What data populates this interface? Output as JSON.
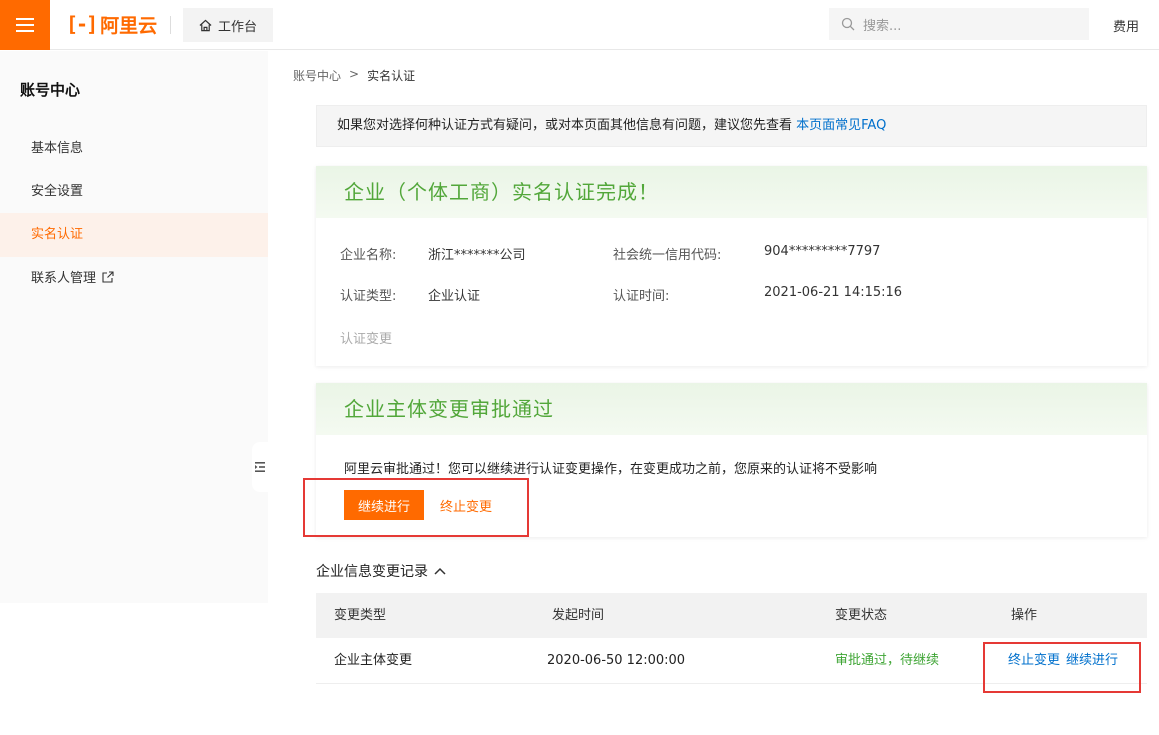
{
  "topbar": {
    "logo_mark": "[-]",
    "logo_text": "阿里云",
    "workbench_label": "工作台",
    "search_placeholder": "搜索...",
    "fee_label": "费用"
  },
  "sidebar": {
    "title": "账号中心",
    "items": [
      {
        "label": "基本信息"
      },
      {
        "label": "安全设置"
      },
      {
        "label": "实名认证"
      },
      {
        "label": "联系人管理"
      }
    ]
  },
  "breadcrumb": {
    "root": "账号中心",
    "separator": ">",
    "current": "实名认证"
  },
  "notice": {
    "text": "如果您对选择何种认证方式有疑问，或对本页面其他信息有问题，建议您先查看 ",
    "link": "本页面常见FAQ"
  },
  "auth_card": {
    "title": "企业（个体工商）实名认证完成！",
    "company_name_label": "企业名称:",
    "company_name_value": "浙江*******公司",
    "credit_code_label": "社会统一信用代码:",
    "credit_code_value": "904*********7797",
    "auth_type_label": "认证类型:",
    "auth_type_value": "企业认证",
    "auth_time_label": "认证时间:",
    "auth_time_value": "2021-06-21 14:15:16",
    "change_link": "认证变更"
  },
  "approval_card": {
    "title": "企业主体变更审批通过",
    "message": "阿里云审批通过！您可以继续进行认证变更操作，在变更成功之前，您原来的认证将不受影响",
    "continue_button": "继续进行",
    "stop_link": "终止变更"
  },
  "records": {
    "title": "企业信息变更记录",
    "columns": [
      "变更类型",
      "发起时间",
      "变更状态",
      "操作"
    ],
    "rows": [
      {
        "type": "企业主体变更",
        "time": "2020-06-50 12:00:00",
        "status": "审批通过，待继续",
        "op_stop": "终止变更",
        "op_continue": "继续进行"
      }
    ]
  },
  "colors": {
    "brand": "#ff6a00",
    "success": "#52a73a",
    "link": "#0070cc",
    "highlight_box": "#e53935"
  }
}
